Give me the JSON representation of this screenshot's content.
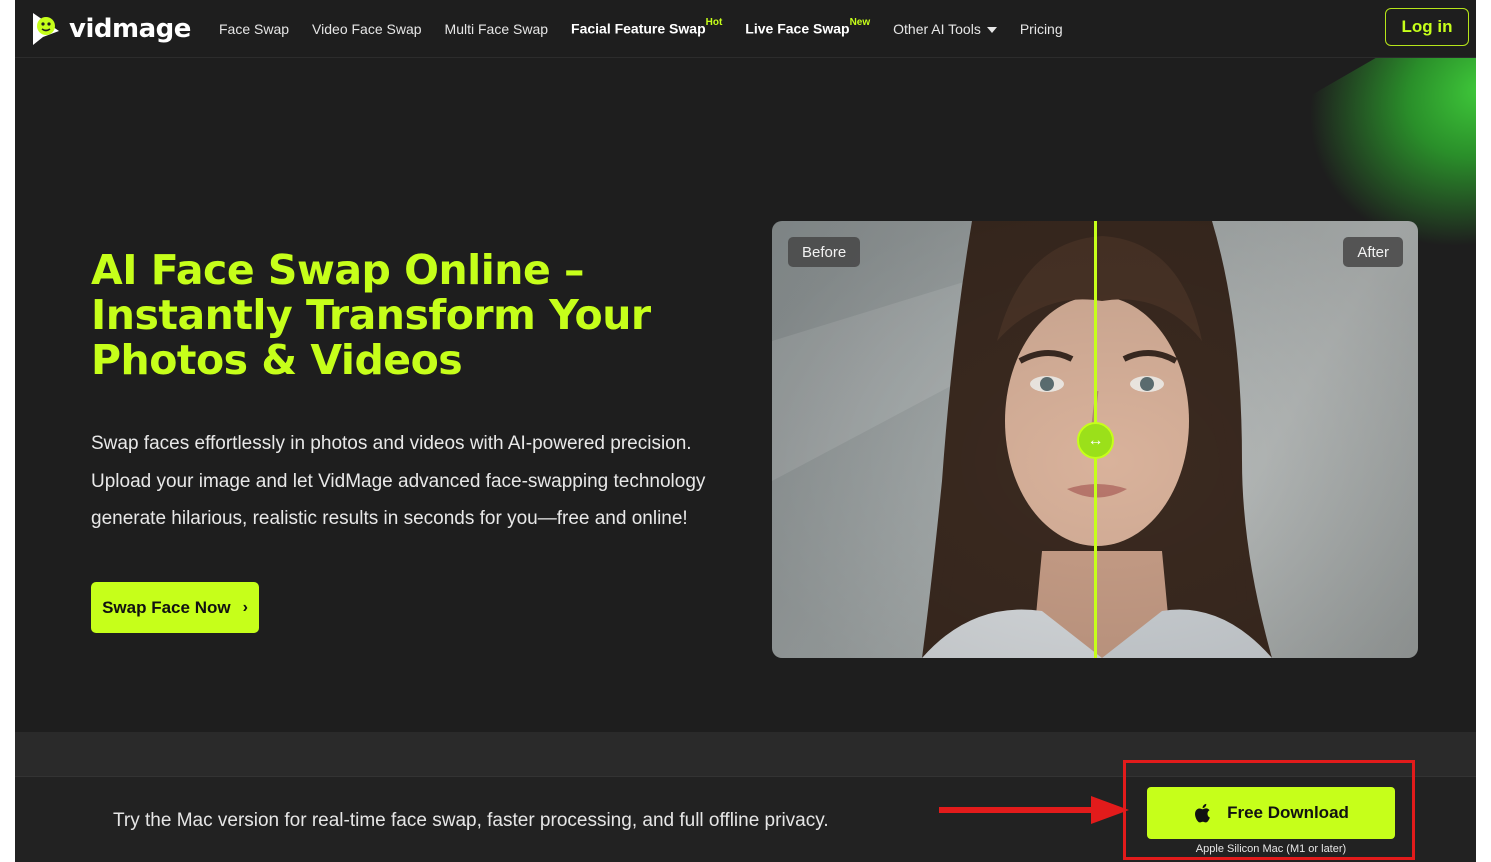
{
  "brand": {
    "name": "vidmage",
    "logo_icon": "vidmage-logo-icon",
    "accent": "#c6ff1a"
  },
  "nav": {
    "items": [
      {
        "label": "Face Swap",
        "bold": false
      },
      {
        "label": "Video Face Swap",
        "bold": false
      },
      {
        "label": "Multi Face Swap",
        "bold": false
      },
      {
        "label": "Facial Feature Swap",
        "badge": "Hot",
        "bold": true
      },
      {
        "label": "Live Face Swap",
        "badge": "New",
        "bold": true
      },
      {
        "label": "Other AI Tools",
        "dropdown": true,
        "bold": false
      },
      {
        "label": "Pricing",
        "bold": false
      }
    ],
    "login_label": "Log in"
  },
  "hero": {
    "title_lines": [
      "AI Face Swap Online –",
      "Instantly Transform Your",
      "Photos & Videos"
    ],
    "desc_lines": [
      "Swap faces effortlessly in photos and videos with AI-powered precision.",
      "Upload your image and let VidMage advanced face-swapping technology",
      "generate hilarious, realistic results in seconds for you—free and online!"
    ],
    "cta_label": "Swap Face Now",
    "cta_icon": "chevron-right-icon"
  },
  "compare": {
    "before_label": "Before",
    "after_label": "After",
    "handle_icon": "left-right-arrows-icon",
    "handle_position": 0.5
  },
  "mac_banner": {
    "text": "Try the Mac version for real-time face swap, faster processing, and full offline privacy.",
    "download_label": "Free Download",
    "download_icon": "apple-icon",
    "download_sub": "Apple Silicon Mac (M1 or later)",
    "annotation_color": "#e21b1b"
  }
}
